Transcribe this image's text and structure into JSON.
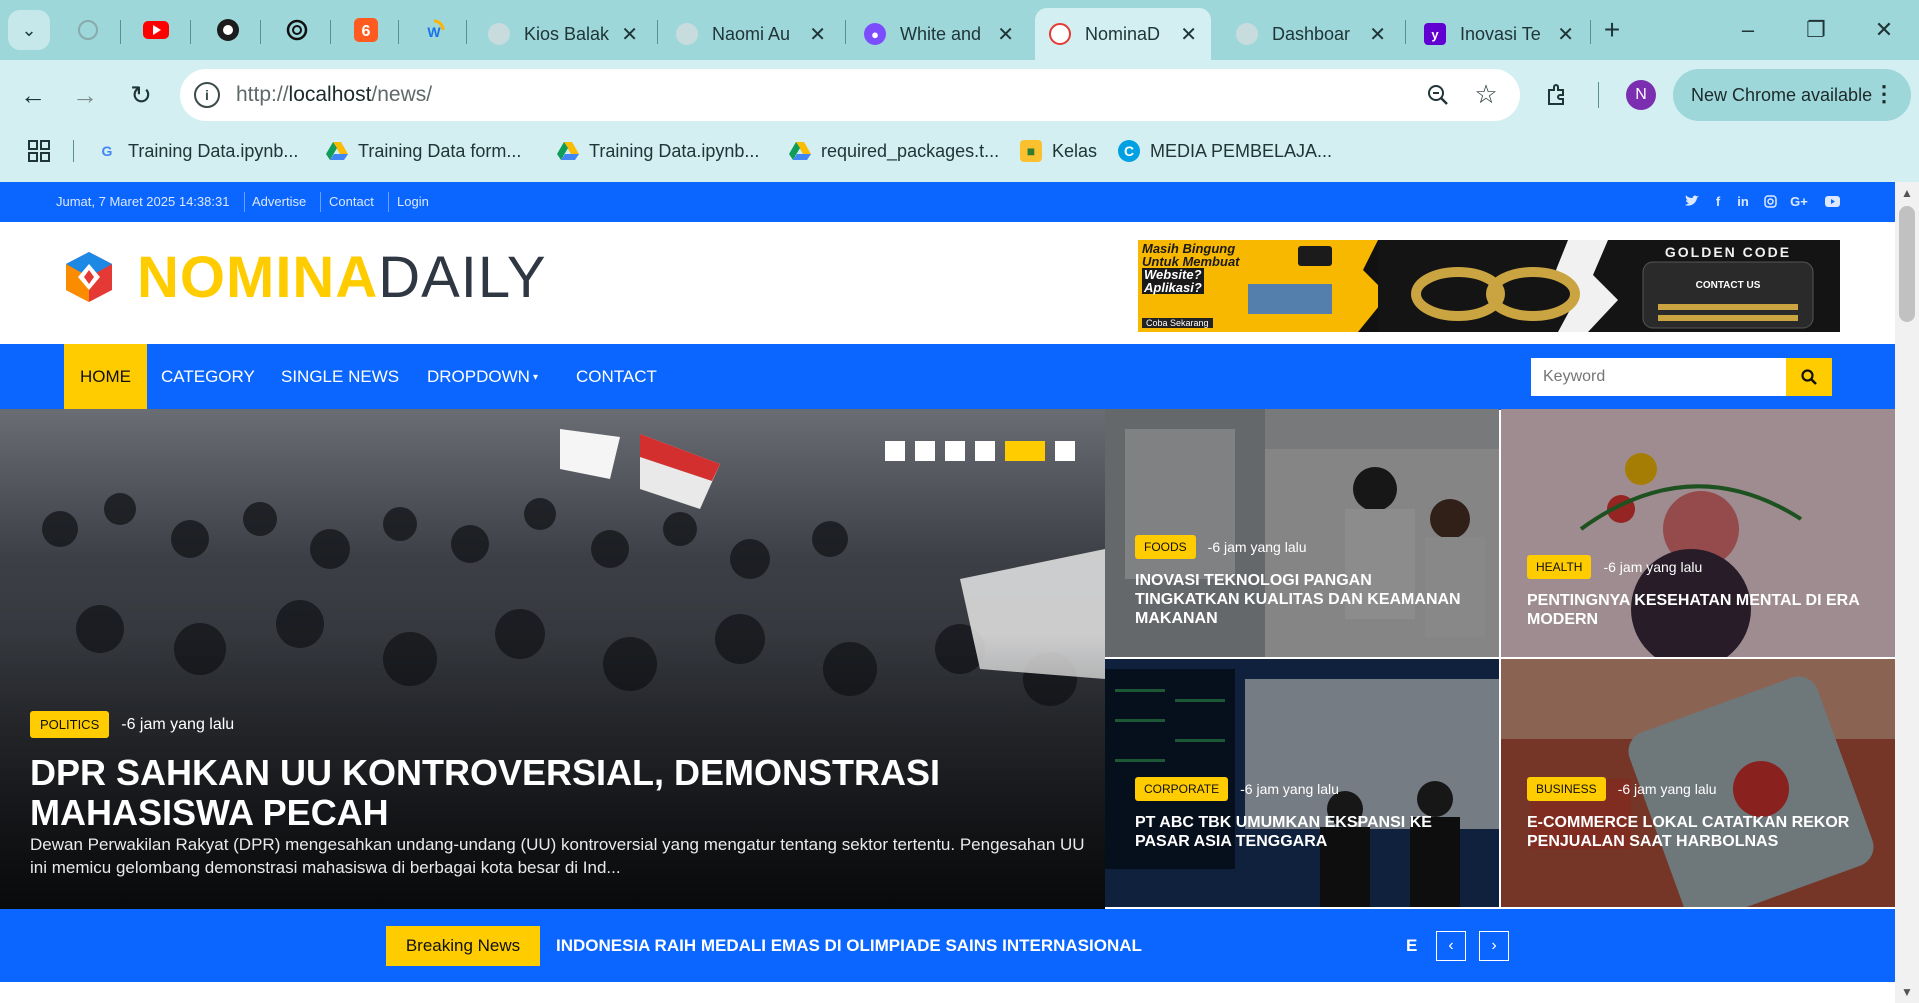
{
  "browser": {
    "tabs": [
      {
        "label": "Kios Balak"
      },
      {
        "label": "Naomi Au"
      },
      {
        "label": "White and"
      },
      {
        "label": "NominaD"
      },
      {
        "label": "Dashboar"
      },
      {
        "label": "Inovasi Te"
      }
    ],
    "url_scheme": "http://",
    "url_host": "localhost",
    "url_path": "/news/",
    "profile_initial": "N",
    "update_label": "New Chrome available",
    "bookmarks": [
      {
        "label": "Training Data.ipynb..."
      },
      {
        "label": "Training Data form..."
      },
      {
        "label": "Training Data.ipynb..."
      },
      {
        "label": "required_packages.t..."
      },
      {
        "label": "Kelas"
      },
      {
        "label": "MEDIA PEMBELAJA..."
      }
    ]
  },
  "site": {
    "topbar": {
      "date": "Jumat, 7 Maret 2025 14:38:31",
      "links": [
        "Advertise",
        "Contact",
        "Login"
      ]
    },
    "logo": {
      "part1": "NOMINA",
      "part2": "DAILY"
    },
    "ad": {
      "left_lines": [
        "Masih Bingung",
        "Untuk Membuat",
        "Website?",
        "Aplikasi?"
      ],
      "cta": "Coba Sekarang",
      "brand": "GOLDEN CODE",
      "contact": "CONTACT US"
    },
    "nav": {
      "items": [
        "Home",
        "Category",
        "Single News",
        "Dropdown",
        "Contact"
      ],
      "search_placeholder": "Keyword"
    },
    "hero": {
      "category": "Politics",
      "time": "-6 jam yang lalu",
      "title": "DPR SAHKAN UU KONTROVERSIAL, DEMONSTRASI MAHASISWA PECAH",
      "excerpt": "Dewan Perwakilan Rakyat (DPR) mengesahkan undang-undang (UU) kontroversial yang mengatur tentang sektor tertentu. Pengesahan UU ini memicu gelombang demonstrasi mahasiswa di berbagai kota besar di Ind..."
    },
    "cards": [
      {
        "category": "Foods",
        "time": "-6 jam yang lalu",
        "title": "INOVASI TEKNOLOGI PANGAN TINGKATKAN KUALITAS DAN KEAMANAN MAKANAN"
      },
      {
        "category": "Health",
        "time": "-6 jam yang lalu",
        "title": "PENTINGNYA KESEHATAN MENTAL DI ERA MODERN"
      },
      {
        "category": "Corporate",
        "time": "-6 jam yang lalu",
        "title": "PT ABC TBK UMUMKAN EKSPANSI KE PASAR ASIA TENGGARA"
      },
      {
        "category": "Business",
        "time": "-6 jam yang lalu",
        "title": "E-COMMERCE LOKAL CATATKAN REKOR PENJUALAN SAAT HARBOLNAS"
      }
    ],
    "breaking": {
      "label": "Breaking News",
      "headline": "INDONESIA RAIH MEDALI EMAS DI OLIMPIADE SAINS INTERNASIONAL",
      "next_fragment": "E",
      "prev": "‹",
      "next": "›"
    }
  },
  "colors": {
    "primary_blue": "#0a66ff",
    "accent_yellow": "#ffcc00",
    "chrome_frame": "#9ed7da",
    "chrome_toolbar": "#d3eff1"
  }
}
